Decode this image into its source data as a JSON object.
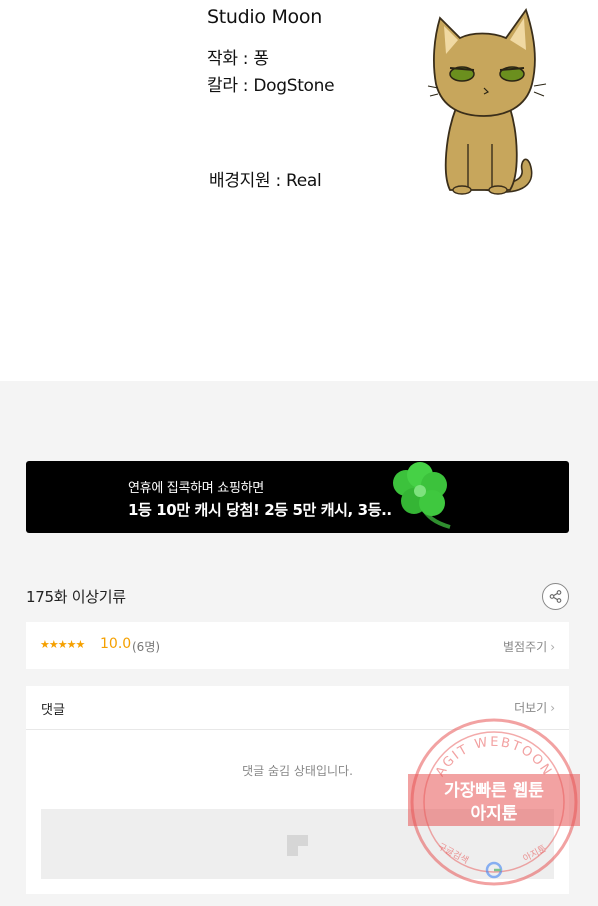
{
  "credits": {
    "studio": "Studio Moon",
    "line1": "작화 : 퐁",
    "line2": "칼라 : DogStone",
    "line3": "배경지원 : Real"
  },
  "ad_banner": {
    "line1": "연휴에 집콕하며 쇼핑하면",
    "line2": "1등 10만 캐시 당첨! 2등 5만 캐시, 3등.."
  },
  "episode": {
    "title": "175화 이상기류"
  },
  "rating": {
    "stars": "★★★★★",
    "score": "10.0",
    "count": "(6명)",
    "rate_label": "별점주기"
  },
  "comments": {
    "title": "댓글",
    "more_label": "더보기",
    "hidden_message": "댓글 숨김 상태입니다."
  },
  "watermark": {
    "arc_text": "AGIT WEBTOON",
    "band_line1": "가장빠른 웹툰",
    "band_line2": "아지툰",
    "bottom_left": "구글검색",
    "bottom_right": "아지툰"
  },
  "colors": {
    "rating_accent": "#f5a000",
    "stamp_red": "#e85555"
  },
  "icons": {
    "share": "share-icon",
    "chevron": "chevron-right-icon",
    "ad_placeholder": "ad-placeholder-icon"
  }
}
